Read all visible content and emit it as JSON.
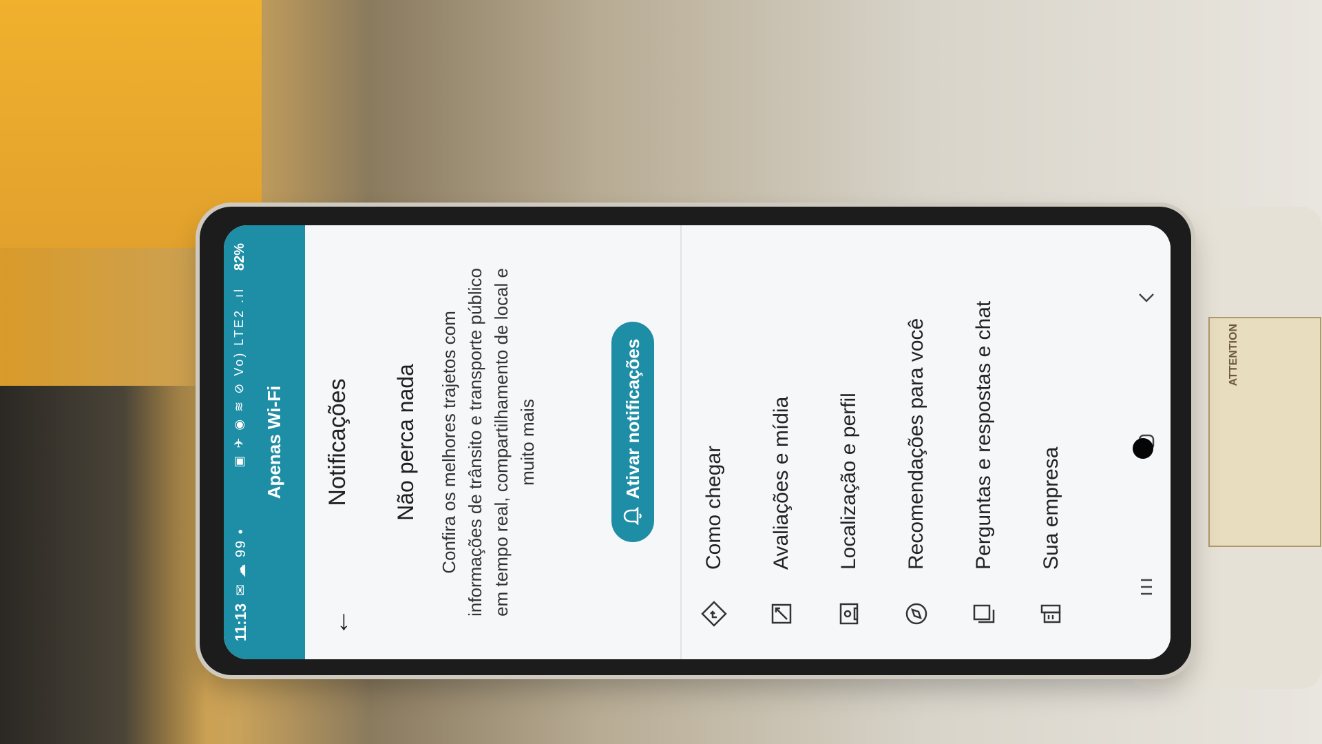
{
  "status_bar": {
    "time": "11:13",
    "left_icons": "✉ ☁ 99 •",
    "right_icons": "▣ ✈ ◉ ≋ ⊘ Vo) LTE2 .ıl",
    "battery": "82%",
    "wifi_banner": "Apenas Wi-Fi"
  },
  "appbar": {
    "title": "Notificações",
    "back_icon": "arrow-back-icon"
  },
  "promo": {
    "title": "Não perca nada",
    "body": "Confira os melhores trajetos com informações de trânsito e transporte público em tempo real, compartilhamento de local e muito mais",
    "button_label": "Ativar notificações",
    "button_icon": "bell-icon",
    "accent_color": "#1d8ea6"
  },
  "list": {
    "items": [
      {
        "label": "Como chegar",
        "icon": "directions-icon"
      },
      {
        "label": "Avaliações e mídia",
        "icon": "review-media-icon"
      },
      {
        "label": "Localização e perfil",
        "icon": "location-profile-icon"
      },
      {
        "label": "Recomendações para você",
        "icon": "explore-compass-icon"
      },
      {
        "label": "Perguntas e respostas e chat",
        "icon": "qa-chat-icon"
      },
      {
        "label": "Sua empresa",
        "icon": "business-icon"
      }
    ]
  },
  "navbar": {
    "recents_icon": "recents-icon",
    "home_icon": "home-icon",
    "back_icon": "nav-back-icon"
  },
  "background": {
    "label_text": "ATTENTION"
  }
}
